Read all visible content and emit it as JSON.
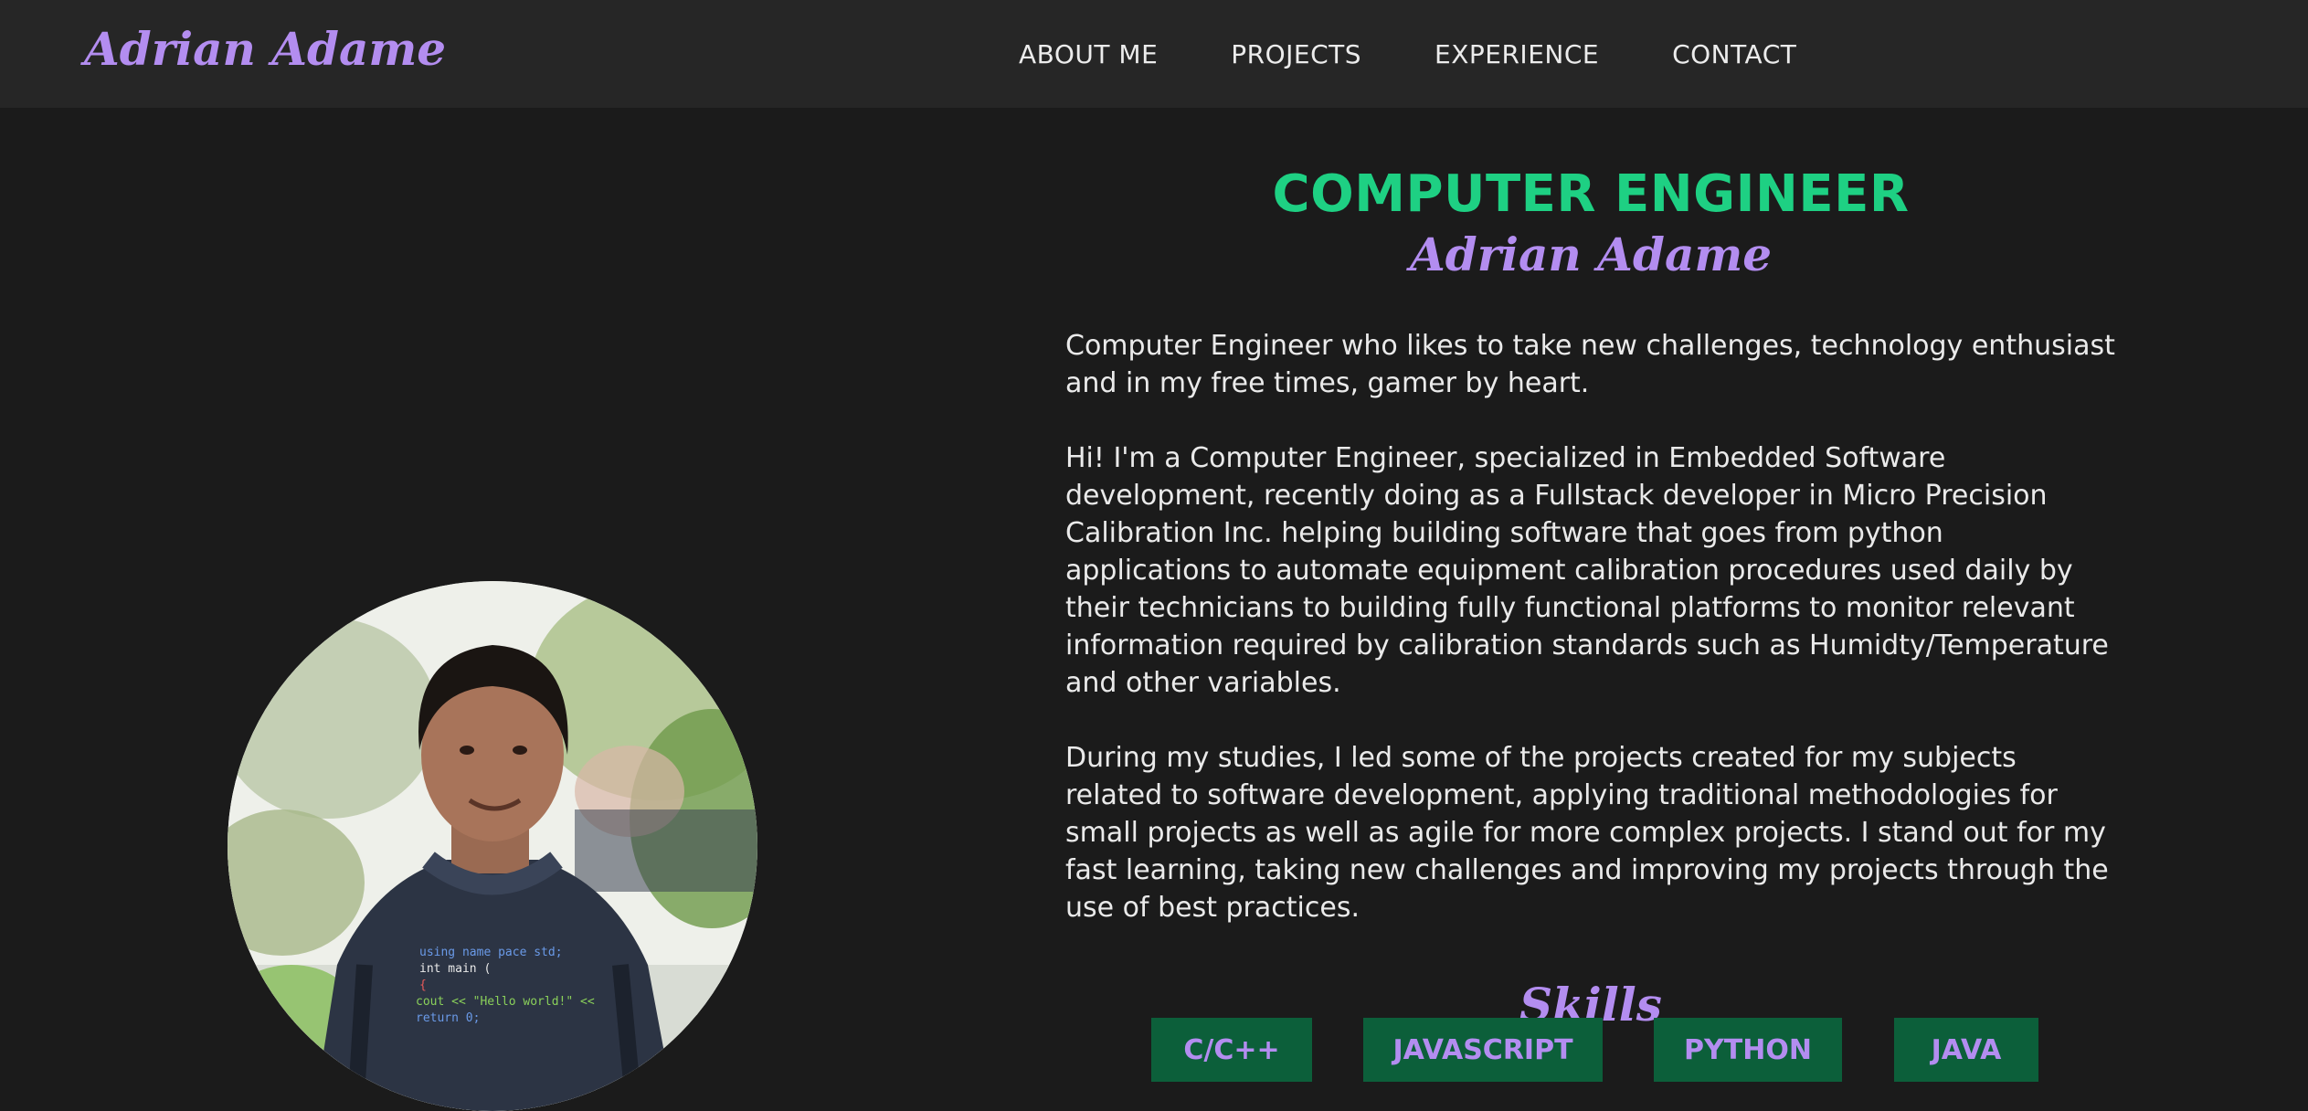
{
  "nav": {
    "brand": "Adrian Adame",
    "links": [
      "ABOUT ME",
      "PROJECTS",
      "EXPERIENCE",
      "CONTACT"
    ]
  },
  "hero": {
    "title": "COMPUTER ENGINEER",
    "name": "Adrian Adame",
    "paragraphs": [
      "Computer Engineer who likes to take new challenges, technology enthusiast and in my free times, gamer by heart.",
      "Hi! I'm a Computer Engineer, specialized in Embedded Software development, recently doing as a Fullstack developer in Micro Precision Calibration Inc. helping building software that goes from python applications to automate equipment calibration procedures used daily by their technicians to building fully functional platforms to monitor relevant information required by calibration standards such as Humidty/Temperature and other variables.",
      "During my studies, I led some of the projects created for my subjects related to software development, applying traditional methodologies for small projects as well as agile for more complex projects. I stand out for my fast learning, taking new challenges and improving my projects through the use of best practices."
    ]
  },
  "skills": {
    "title": "Skills",
    "items": [
      "C/C++",
      "JAVASCRIPT",
      "PYTHON",
      "JAVA"
    ]
  },
  "photo": {
    "shirt_code": [
      "using name pace std;",
      "int main (",
      "{",
      "cout << \"Hello world!\" <<",
      "return 0;"
    ]
  },
  "colors": {
    "accent_green": "#1ed083",
    "accent_purple": "#b38df0",
    "skill_bg": "#0c5f3a",
    "page_bg": "#1b1b1b",
    "nav_bg": "#262626"
  }
}
